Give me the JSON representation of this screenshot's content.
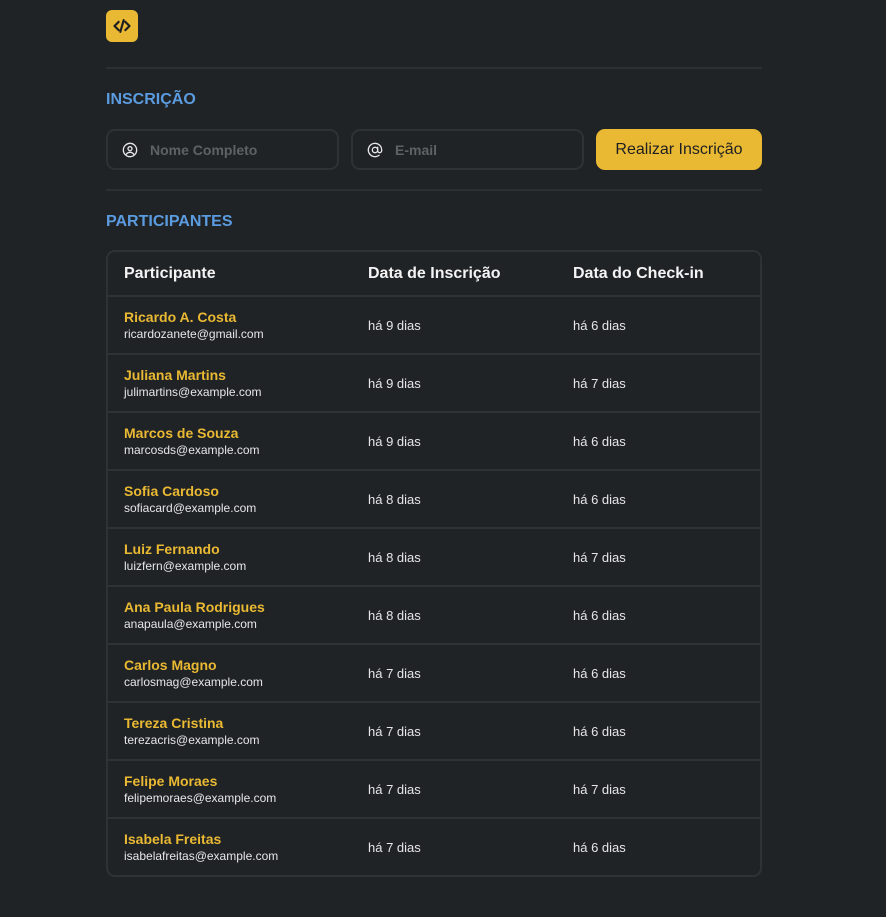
{
  "logo": {
    "icon": "code-icon",
    "color": "#eab933"
  },
  "signup": {
    "title": "INSCRIÇÃO",
    "name_placeholder": "Nome Completo",
    "email_placeholder": "E-mail",
    "name_value": "",
    "email_value": "",
    "submit_label": "Realizar Inscrição"
  },
  "participants": {
    "title": "PARTICIPANTES",
    "columns": [
      "Participante",
      "Data de Inscrição",
      "Data do Check-in"
    ],
    "rows": [
      {
        "name": "Ricardo A. Costa",
        "email": "ricardozanete@gmail.com",
        "registered": "há 9 dias",
        "checkin": "há 6 dias"
      },
      {
        "name": "Juliana Martins",
        "email": "julimartins@example.com",
        "registered": "há 9 dias",
        "checkin": "há 7 dias"
      },
      {
        "name": "Marcos de Souza",
        "email": "marcosds@example.com",
        "registered": "há 9 dias",
        "checkin": "há 6 dias"
      },
      {
        "name": "Sofia Cardoso",
        "email": "sofiacard@example.com",
        "registered": "há 8 dias",
        "checkin": "há 6 dias"
      },
      {
        "name": "Luiz Fernando",
        "email": "luizfern@example.com",
        "registered": "há 8 dias",
        "checkin": "há 7 dias"
      },
      {
        "name": "Ana Paula Rodrigues",
        "email": "anapaula@example.com",
        "registered": "há 8 dias",
        "checkin": "há 6 dias"
      },
      {
        "name": "Carlos Magno",
        "email": "carlosmag@example.com",
        "registered": "há 7 dias",
        "checkin": "há 6 dias"
      },
      {
        "name": "Tereza Cristina",
        "email": "terezacris@example.com",
        "registered": "há 7 dias",
        "checkin": "há 6 dias"
      },
      {
        "name": "Felipe Moraes",
        "email": "felipemoraes@example.com",
        "registered": "há 7 dias",
        "checkin": "há 7 dias"
      },
      {
        "name": "Isabela Freitas",
        "email": "isabelafreitas@example.com",
        "registered": "há 7 dias",
        "checkin": "há 6 dias"
      }
    ]
  }
}
